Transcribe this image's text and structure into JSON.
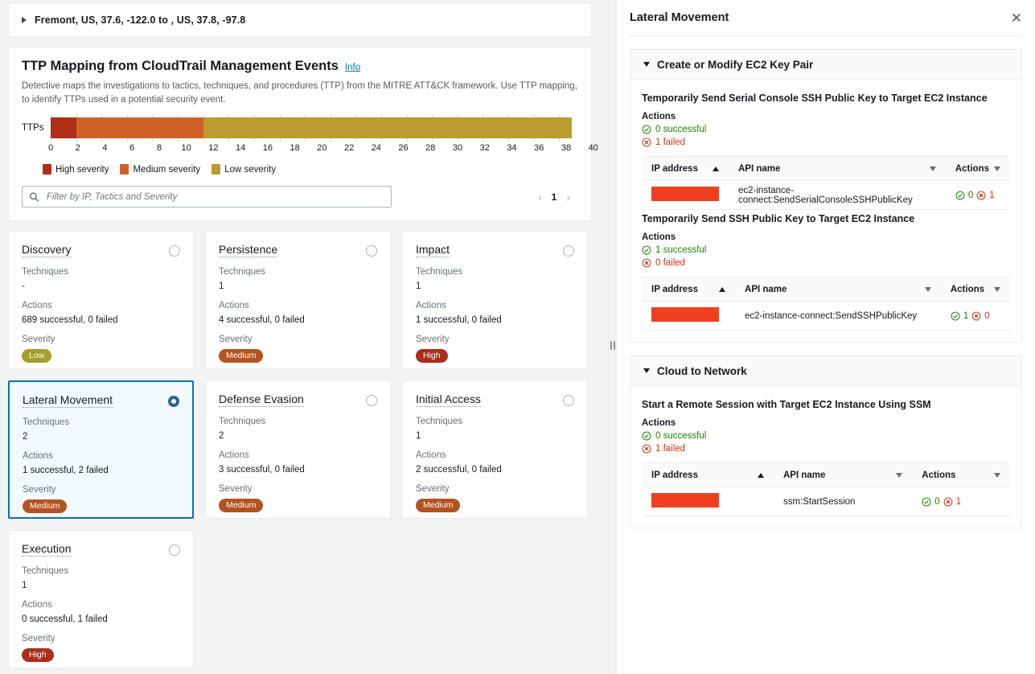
{
  "left": {
    "geo_row": {
      "label": "Fremont, US, 37.6, -122.0 to , US, 37.8, -97.8",
      "caret": "caret-right-icon"
    },
    "ttp_card": {
      "title": "TTP Mapping from CloudTrail Management Events",
      "info_label": "Info",
      "description": "Detective maps the investigations to tactics, techniques, and procedures (TTP) from the MITRE ATT&CK framework. Use TTP mapping, to identify TTPs used in a potential security event.",
      "search_placeholder": "Filter by IP, Tactics and Severity",
      "search_value": "",
      "search_icon": "search-icon",
      "pagination": {
        "prev": "‹",
        "page": "1",
        "next": "›"
      }
    },
    "tactics": [
      {
        "name": "Discovery",
        "techniques_label": "Techniques",
        "techniques": "-",
        "actions_label": "Actions",
        "actions": "689 successful, 0 failed",
        "severity_label": "Severity",
        "severity": "Low",
        "severity_color": "#a5a02a",
        "selected": false
      },
      {
        "name": "Persistence",
        "techniques_label": "Techniques",
        "techniques": "1",
        "actions_label": "Actions",
        "actions": "4 successful, 0 failed",
        "severity_label": "Severity",
        "severity": "Medium",
        "severity_color": "#b4531f",
        "selected": false
      },
      {
        "name": "Impact",
        "techniques_label": "Techniques",
        "techniques": "1",
        "actions_label": "Actions",
        "actions": "1 successful, 0 failed",
        "severity_label": "Severity",
        "severity": "High",
        "severity_color": "#aa2e19",
        "selected": false
      },
      {
        "name": "Lateral Movement",
        "techniques_label": "Techniques",
        "techniques": "2",
        "actions_label": "Actions",
        "actions": "1 successful, 2 failed",
        "severity_label": "Severity",
        "severity": "Medium",
        "severity_color": "#b4531f",
        "selected": true
      },
      {
        "name": "Defense Evasion",
        "techniques_label": "Techniques",
        "techniques": "2",
        "actions_label": "Actions",
        "actions": "3 successful, 0 failed",
        "severity_label": "Severity",
        "severity": "Medium",
        "severity_color": "#b4531f",
        "selected": false
      },
      {
        "name": "Initial Access",
        "techniques_label": "Techniques",
        "techniques": "1",
        "actions_label": "Actions",
        "actions": "2 successful, 0 failed",
        "severity_label": "Severity",
        "severity": "Medium",
        "severity_color": "#b4531f",
        "selected": false
      },
      {
        "name": "Execution",
        "techniques_label": "Techniques",
        "techniques": "1",
        "actions_label": "Actions",
        "actions": "0 successful, 1 failed",
        "severity_label": "Severity",
        "severity": "High",
        "severity_color": "#aa2e19",
        "selected": false
      }
    ]
  },
  "chart_data": {
    "type": "bar",
    "orientation": "horizontal",
    "stacked": true,
    "title": "TTP Mapping from CloudTrail Management Events",
    "categories": [
      "TTPs"
    ],
    "series": [
      {
        "name": "High severity",
        "values": [
          2
        ],
        "color": "#b02d16"
      },
      {
        "name": "Medium severity",
        "values": [
          10
        ],
        "color": "#cf6229"
      },
      {
        "name": "Low severity",
        "values": [
          29
        ],
        "color": "#bb9c32"
      }
    ],
    "xlabel": "",
    "ylabel": "TTPs",
    "xlim": [
      0,
      41.5
    ],
    "xticks": [
      0,
      2,
      4,
      6,
      8,
      10,
      12,
      14,
      16,
      18,
      20,
      22,
      24,
      26,
      28,
      30,
      32,
      34,
      36,
      38,
      40
    ],
    "grid": true,
    "legend_position": "bottom-left",
    "total": 41
  },
  "splitter": {
    "name": "panel-resize-handle"
  },
  "right": {
    "title": "Lateral Movement",
    "close_label": "✕",
    "sections": [
      {
        "title": "Create or Modify EC2 Key Pair",
        "expanded": true,
        "techniques": [
          {
            "title": "Temporarily Send Serial Console SSH Public Key to Target EC2 Instance",
            "actions_label": "Actions",
            "successful": "0 successful",
            "failed": "1 failed",
            "columns": [
              "IP address",
              "API name",
              "Actions"
            ],
            "rows": [
              {
                "ip": "",
                "ip_redacted": true,
                "api_name": "ec2-instance-connect:SendSerialConsoleSSHPublicKey",
                "ok_count": "0",
                "fail_count": "1"
              }
            ]
          },
          {
            "title": "Temporarily Send SSH Public Key to Target EC2 Instance",
            "actions_label": "Actions",
            "successful": "1 successful",
            "failed": "0 failed",
            "columns": [
              "IP address",
              "API name",
              "Actions"
            ],
            "rows": [
              {
                "ip": "",
                "ip_redacted": true,
                "api_name": "ec2-instance-connect:SendSSHPublicKey",
                "ok_count": "1",
                "fail_count": "0"
              }
            ]
          }
        ]
      },
      {
        "title": "Cloud to Network",
        "expanded": true,
        "techniques": [
          {
            "title": "Start a Remote Session with Target EC2 Instance Using SSM",
            "actions_label": "Actions",
            "successful": "0 successful",
            "failed": "1 failed",
            "columns": [
              "IP address",
              "API name",
              "Actions"
            ],
            "rows": [
              {
                "ip": "",
                "ip_redacted": true,
                "api_name": "ssm:StartSession",
                "ok_count": "0",
                "fail_count": "1"
              }
            ]
          }
        ]
      }
    ]
  }
}
